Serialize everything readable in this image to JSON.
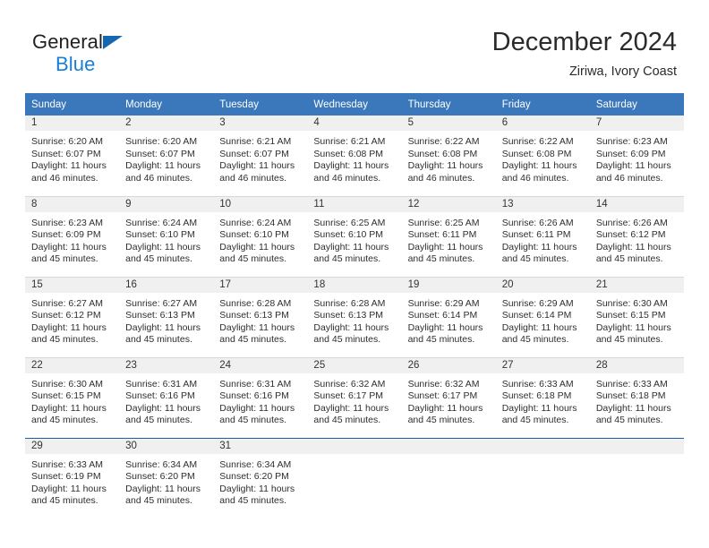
{
  "brand": {
    "line1": "General",
    "line2": "Blue",
    "flag_color": "#1567b0",
    "text_color": "#231f20",
    "blue_text_color": "#1a7fd4"
  },
  "header": {
    "title": "December 2024",
    "subtitle": "Ziriwa, Ivory Coast"
  },
  "theme": {
    "header_row_bg": "#3a77bb",
    "day_band_bg": "#f0f0f0",
    "grid_line": "#d8d8d8",
    "accent_line": "#1f5fa0"
  },
  "weekday_headers": [
    "Sunday",
    "Monday",
    "Tuesday",
    "Wednesday",
    "Thursday",
    "Friday",
    "Saturday"
  ],
  "weeks": [
    [
      {
        "day": "1",
        "sunrise": "Sunrise: 6:20 AM",
        "sunset": "Sunset: 6:07 PM",
        "daylight1": "Daylight: 11 hours",
        "daylight2": "and 46 minutes."
      },
      {
        "day": "2",
        "sunrise": "Sunrise: 6:20 AM",
        "sunset": "Sunset: 6:07 PM",
        "daylight1": "Daylight: 11 hours",
        "daylight2": "and 46 minutes."
      },
      {
        "day": "3",
        "sunrise": "Sunrise: 6:21 AM",
        "sunset": "Sunset: 6:07 PM",
        "daylight1": "Daylight: 11 hours",
        "daylight2": "and 46 minutes."
      },
      {
        "day": "4",
        "sunrise": "Sunrise: 6:21 AM",
        "sunset": "Sunset: 6:08 PM",
        "daylight1": "Daylight: 11 hours",
        "daylight2": "and 46 minutes."
      },
      {
        "day": "5",
        "sunrise": "Sunrise: 6:22 AM",
        "sunset": "Sunset: 6:08 PM",
        "daylight1": "Daylight: 11 hours",
        "daylight2": "and 46 minutes."
      },
      {
        "day": "6",
        "sunrise": "Sunrise: 6:22 AM",
        "sunset": "Sunset: 6:08 PM",
        "daylight1": "Daylight: 11 hours",
        "daylight2": "and 46 minutes."
      },
      {
        "day": "7",
        "sunrise": "Sunrise: 6:23 AM",
        "sunset": "Sunset: 6:09 PM",
        "daylight1": "Daylight: 11 hours",
        "daylight2": "and 46 minutes."
      }
    ],
    [
      {
        "day": "8",
        "sunrise": "Sunrise: 6:23 AM",
        "sunset": "Sunset: 6:09 PM",
        "daylight1": "Daylight: 11 hours",
        "daylight2": "and 45 minutes."
      },
      {
        "day": "9",
        "sunrise": "Sunrise: 6:24 AM",
        "sunset": "Sunset: 6:10 PM",
        "daylight1": "Daylight: 11 hours",
        "daylight2": "and 45 minutes."
      },
      {
        "day": "10",
        "sunrise": "Sunrise: 6:24 AM",
        "sunset": "Sunset: 6:10 PM",
        "daylight1": "Daylight: 11 hours",
        "daylight2": "and 45 minutes."
      },
      {
        "day": "11",
        "sunrise": "Sunrise: 6:25 AM",
        "sunset": "Sunset: 6:10 PM",
        "daylight1": "Daylight: 11 hours",
        "daylight2": "and 45 minutes."
      },
      {
        "day": "12",
        "sunrise": "Sunrise: 6:25 AM",
        "sunset": "Sunset: 6:11 PM",
        "daylight1": "Daylight: 11 hours",
        "daylight2": "and 45 minutes."
      },
      {
        "day": "13",
        "sunrise": "Sunrise: 6:26 AM",
        "sunset": "Sunset: 6:11 PM",
        "daylight1": "Daylight: 11 hours",
        "daylight2": "and 45 minutes."
      },
      {
        "day": "14",
        "sunrise": "Sunrise: 6:26 AM",
        "sunset": "Sunset: 6:12 PM",
        "daylight1": "Daylight: 11 hours",
        "daylight2": "and 45 minutes."
      }
    ],
    [
      {
        "day": "15",
        "sunrise": "Sunrise: 6:27 AM",
        "sunset": "Sunset: 6:12 PM",
        "daylight1": "Daylight: 11 hours",
        "daylight2": "and 45 minutes."
      },
      {
        "day": "16",
        "sunrise": "Sunrise: 6:27 AM",
        "sunset": "Sunset: 6:13 PM",
        "daylight1": "Daylight: 11 hours",
        "daylight2": "and 45 minutes."
      },
      {
        "day": "17",
        "sunrise": "Sunrise: 6:28 AM",
        "sunset": "Sunset: 6:13 PM",
        "daylight1": "Daylight: 11 hours",
        "daylight2": "and 45 minutes."
      },
      {
        "day": "18",
        "sunrise": "Sunrise: 6:28 AM",
        "sunset": "Sunset: 6:13 PM",
        "daylight1": "Daylight: 11 hours",
        "daylight2": "and 45 minutes."
      },
      {
        "day": "19",
        "sunrise": "Sunrise: 6:29 AM",
        "sunset": "Sunset: 6:14 PM",
        "daylight1": "Daylight: 11 hours",
        "daylight2": "and 45 minutes."
      },
      {
        "day": "20",
        "sunrise": "Sunrise: 6:29 AM",
        "sunset": "Sunset: 6:14 PM",
        "daylight1": "Daylight: 11 hours",
        "daylight2": "and 45 minutes."
      },
      {
        "day": "21",
        "sunrise": "Sunrise: 6:30 AM",
        "sunset": "Sunset: 6:15 PM",
        "daylight1": "Daylight: 11 hours",
        "daylight2": "and 45 minutes."
      }
    ],
    [
      {
        "day": "22",
        "sunrise": "Sunrise: 6:30 AM",
        "sunset": "Sunset: 6:15 PM",
        "daylight1": "Daylight: 11 hours",
        "daylight2": "and 45 minutes."
      },
      {
        "day": "23",
        "sunrise": "Sunrise: 6:31 AM",
        "sunset": "Sunset: 6:16 PM",
        "daylight1": "Daylight: 11 hours",
        "daylight2": "and 45 minutes."
      },
      {
        "day": "24",
        "sunrise": "Sunrise: 6:31 AM",
        "sunset": "Sunset: 6:16 PM",
        "daylight1": "Daylight: 11 hours",
        "daylight2": "and 45 minutes."
      },
      {
        "day": "25",
        "sunrise": "Sunrise: 6:32 AM",
        "sunset": "Sunset: 6:17 PM",
        "daylight1": "Daylight: 11 hours",
        "daylight2": "and 45 minutes."
      },
      {
        "day": "26",
        "sunrise": "Sunrise: 6:32 AM",
        "sunset": "Sunset: 6:17 PM",
        "daylight1": "Daylight: 11 hours",
        "daylight2": "and 45 minutes."
      },
      {
        "day": "27",
        "sunrise": "Sunrise: 6:33 AM",
        "sunset": "Sunset: 6:18 PM",
        "daylight1": "Daylight: 11 hours",
        "daylight2": "and 45 minutes."
      },
      {
        "day": "28",
        "sunrise": "Sunrise: 6:33 AM",
        "sunset": "Sunset: 6:18 PM",
        "daylight1": "Daylight: 11 hours",
        "daylight2": "and 45 minutes."
      }
    ],
    [
      {
        "day": "29",
        "sunrise": "Sunrise: 6:33 AM",
        "sunset": "Sunset: 6:19 PM",
        "daylight1": "Daylight: 11 hours",
        "daylight2": "and 45 minutes."
      },
      {
        "day": "30",
        "sunrise": "Sunrise: 6:34 AM",
        "sunset": "Sunset: 6:20 PM",
        "daylight1": "Daylight: 11 hours",
        "daylight2": "and 45 minutes."
      },
      {
        "day": "31",
        "sunrise": "Sunrise: 6:34 AM",
        "sunset": "Sunset: 6:20 PM",
        "daylight1": "Daylight: 11 hours",
        "daylight2": "and 45 minutes."
      },
      {
        "day": "",
        "sunrise": "",
        "sunset": "",
        "daylight1": "",
        "daylight2": ""
      },
      {
        "day": "",
        "sunrise": "",
        "sunset": "",
        "daylight1": "",
        "daylight2": ""
      },
      {
        "day": "",
        "sunrise": "",
        "sunset": "",
        "daylight1": "",
        "daylight2": ""
      },
      {
        "day": "",
        "sunrise": "",
        "sunset": "",
        "daylight1": "",
        "daylight2": ""
      }
    ]
  ]
}
